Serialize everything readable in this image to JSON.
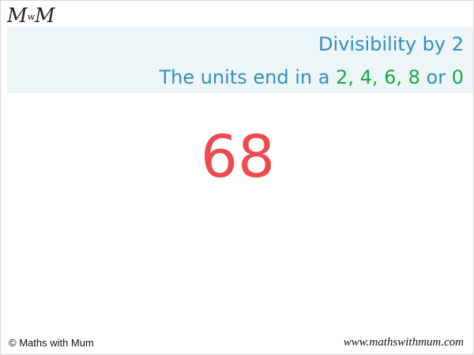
{
  "logo": {
    "left": "M",
    "mid": "w",
    "right": "M"
  },
  "title": "Divisibility by 2",
  "rule": {
    "prefix": "The units end in a ",
    "digits": "2, 4, 6, 8",
    "connector": " or ",
    "last_digit": "0"
  },
  "example_number": "68",
  "footer": {
    "copyright": "© Maths with Mum",
    "website": "www.mathswithmum.com"
  },
  "colors": {
    "title": "#2e8fc3",
    "digits": "#1aa84a",
    "number": "#ef4a4d",
    "header_band": "#eef5f7"
  }
}
